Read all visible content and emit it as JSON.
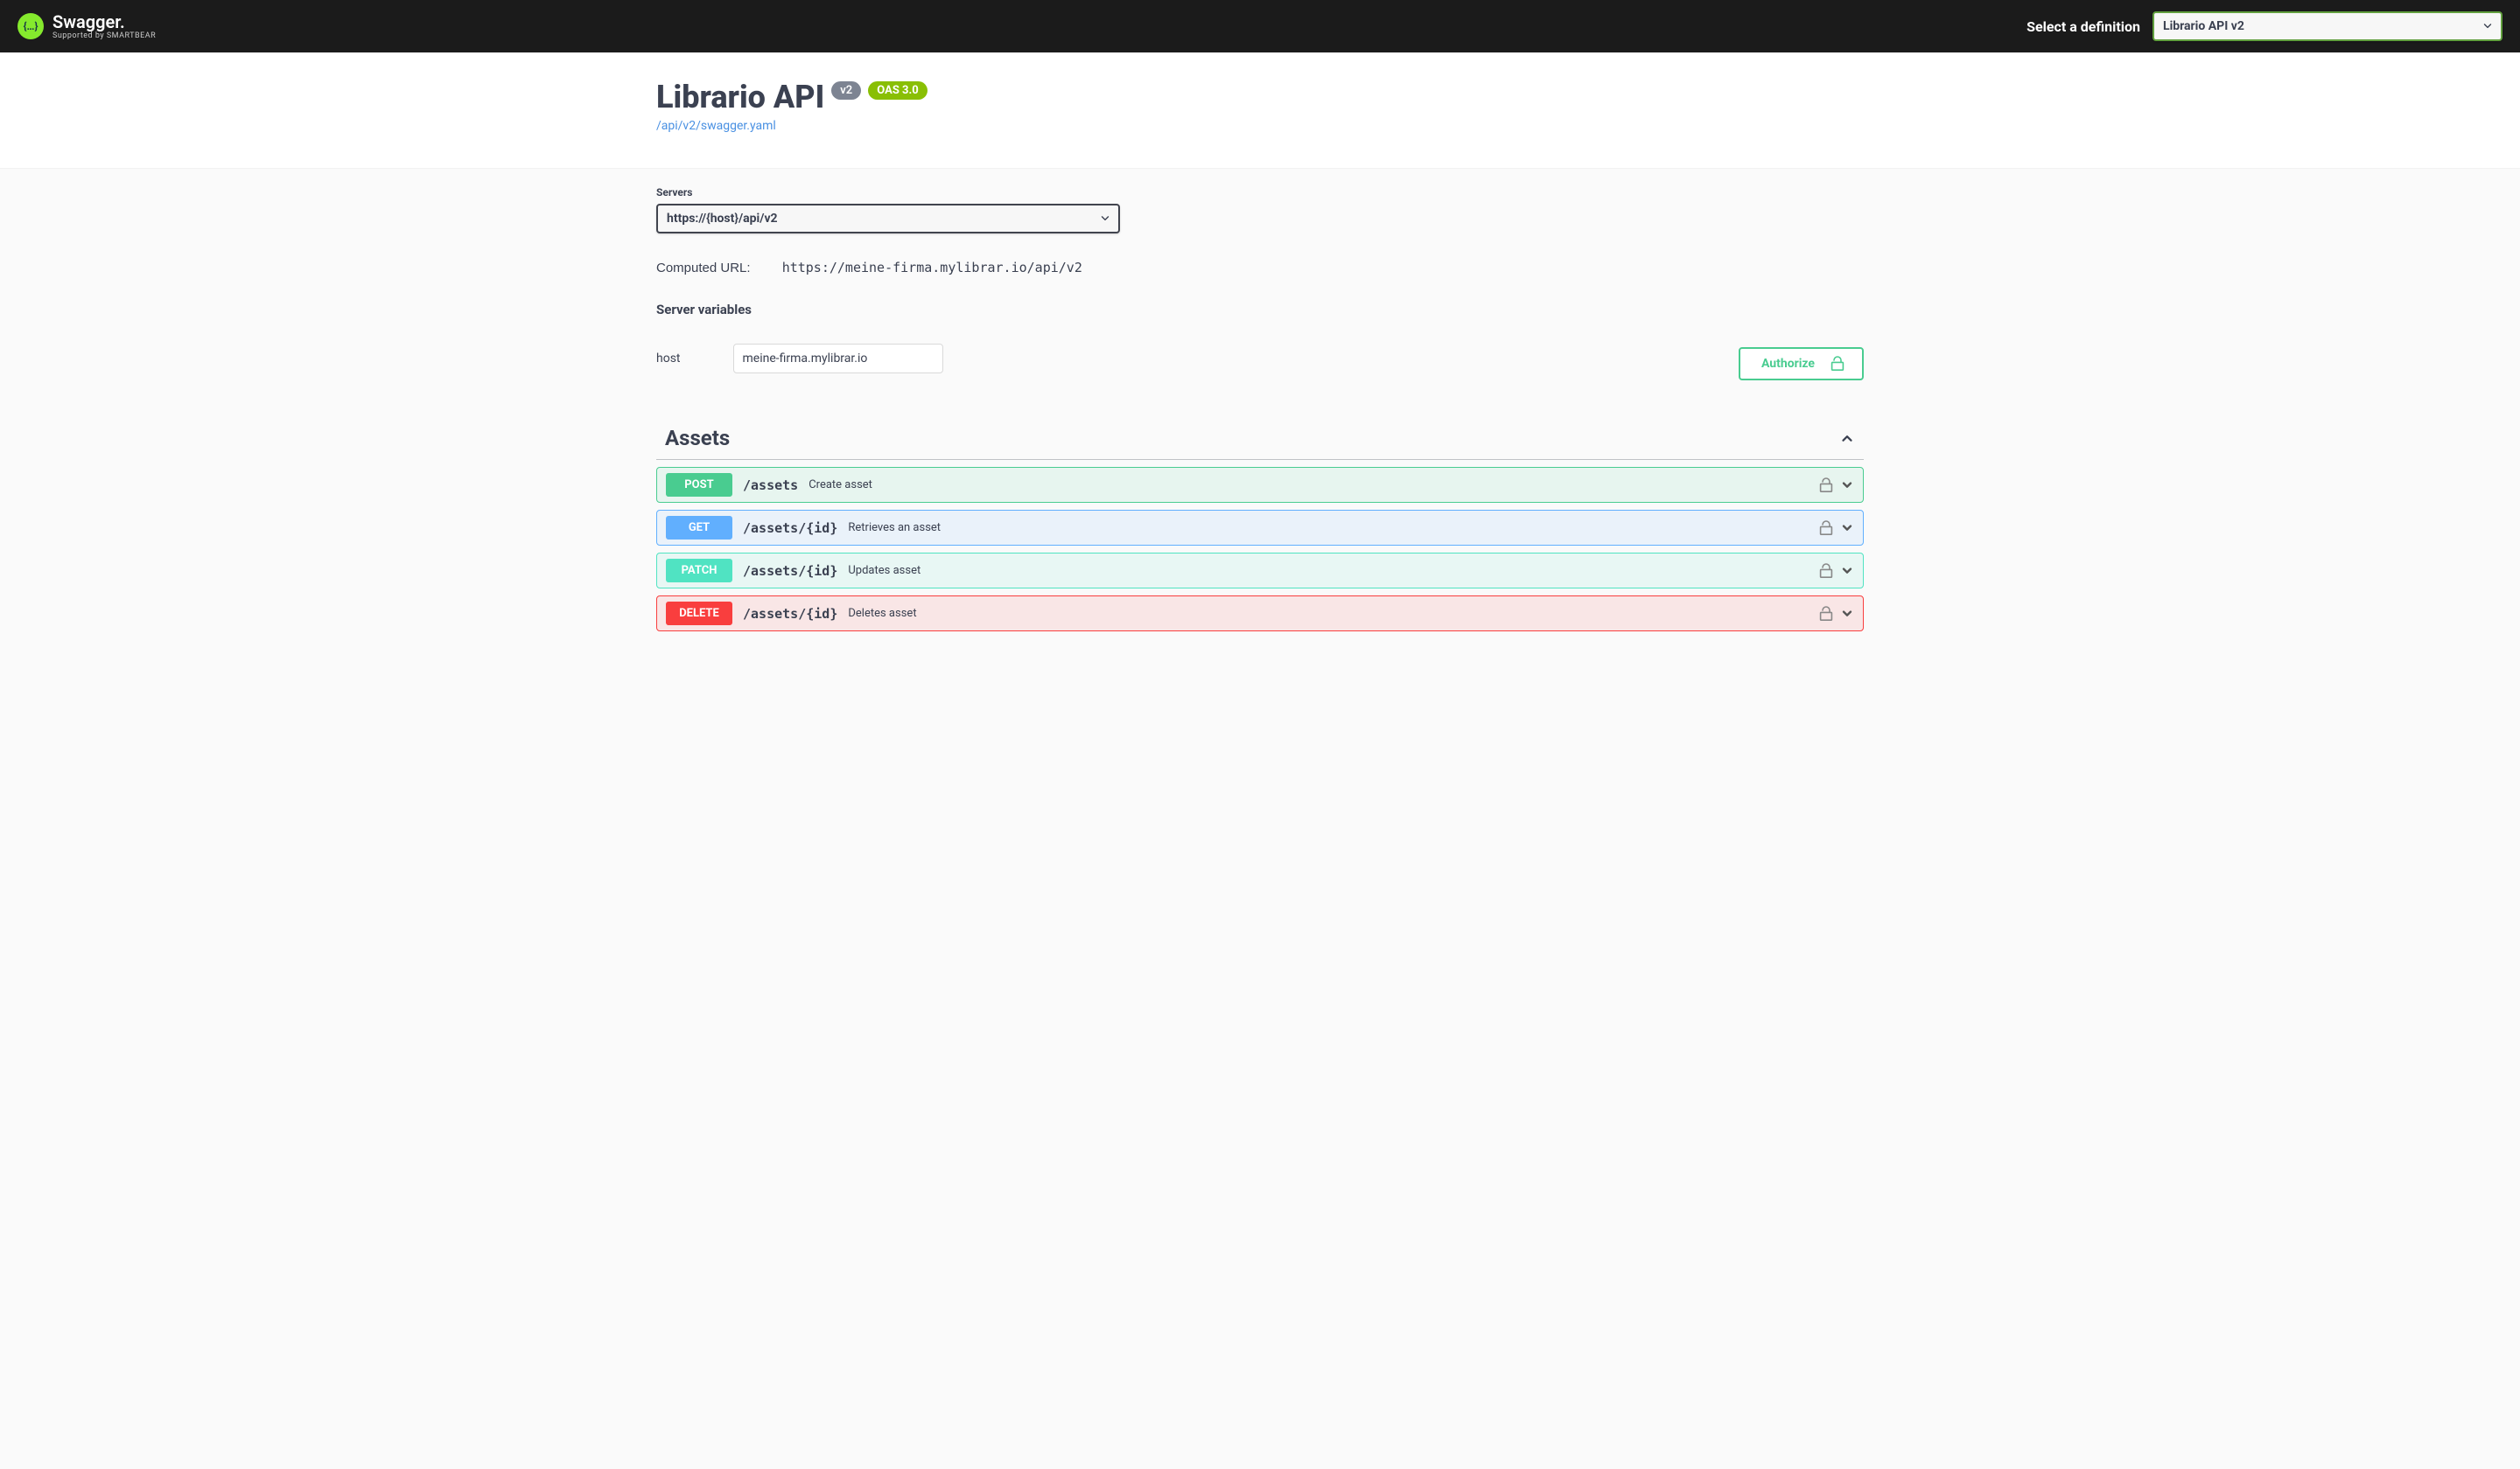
{
  "topbar": {
    "logo_text": "Swagger.",
    "logo_sub": "Supported by SMARTBEAR",
    "select_def_label": "Select a definition",
    "selected_definition": "Librario API v2"
  },
  "info": {
    "title": "Librario API",
    "version": "v2",
    "oas": "OAS 3.0",
    "spec_url": "/api/v2/swagger.yaml"
  },
  "servers": {
    "label": "Servers",
    "selected": "https://{host}/api/v2",
    "computed_label": "Computed URL:",
    "computed_url": "https://meine-firma.mylibrar.io/api/v2",
    "variables_heading": "Server variables",
    "vars": [
      {
        "name": "host",
        "value": "meine-firma.mylibrar.io"
      }
    ]
  },
  "authorize": {
    "label": "Authorize"
  },
  "tags": [
    {
      "name": "Assets",
      "ops": [
        {
          "method": "POST",
          "cls": "post",
          "path": "/assets",
          "summary": "Create asset"
        },
        {
          "method": "GET",
          "cls": "get",
          "path": "/assets/{id}",
          "summary": "Retrieves an asset"
        },
        {
          "method": "PATCH",
          "cls": "patch",
          "path": "/assets/{id}",
          "summary": "Updates asset"
        },
        {
          "method": "DELETE",
          "cls": "delete",
          "path": "/assets/{id}",
          "summary": "Deletes asset"
        }
      ]
    }
  ]
}
